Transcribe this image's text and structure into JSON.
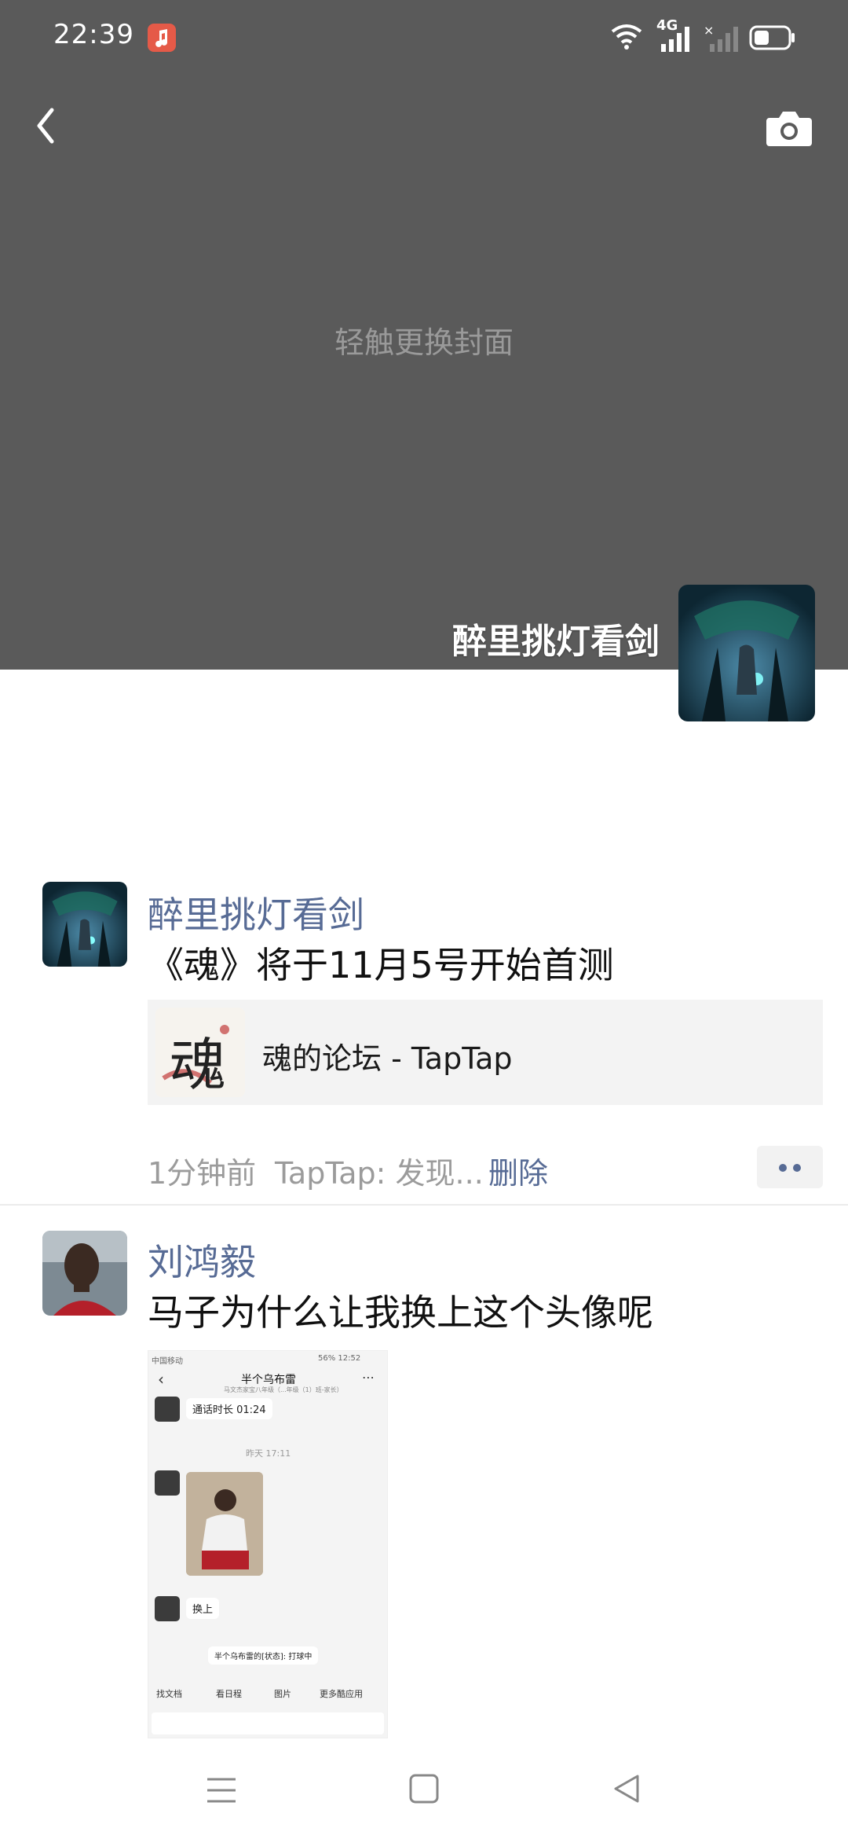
{
  "status_bar": {
    "time": "22:39",
    "network": "4G",
    "icons": [
      "music-icon",
      "wifi-icon",
      "signal-icon",
      "signal-off-icon",
      "battery-icon"
    ]
  },
  "header": {
    "back_icon": "chevron-left-icon",
    "camera_icon": "camera-icon"
  },
  "cover": {
    "hint": "轻触更换封面",
    "name": "醉里挑灯看剑"
  },
  "posts": [
    {
      "author": "醉里挑灯看剑",
      "text": "《魂》将于11月5号开始首测",
      "link": {
        "title": "魂的论坛 - TapTap",
        "thumb_text": "魂"
      },
      "time": "1分钟前",
      "source": "TapTap: 发现...",
      "delete": "删除"
    },
    {
      "author": "刘鸿毅",
      "text": "马子为什么让我换上这个头像呢",
      "image": {
        "status_left": "中国移动",
        "status_right": "56% 12:52",
        "chat_title": "半个乌布雷",
        "chat_sub": "马文杰家宝八年级（...年级（1）班-家长）",
        "call_duration": "通话时长 01:24",
        "timestamp": "昨天 17:11",
        "msg": "换上",
        "status_note": "半个乌布雷的[状态]: 打球中",
        "toolbar": [
          "找文档",
          "看日程",
          "图片",
          "更多酷应用"
        ]
      }
    }
  ],
  "nav": {
    "icons": [
      "menu-icon",
      "home-icon",
      "back-triangle-icon"
    ]
  }
}
